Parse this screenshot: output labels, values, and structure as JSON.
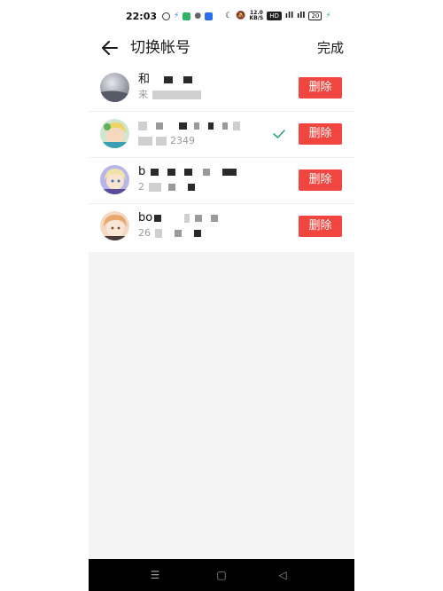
{
  "status_bar": {
    "time": "22:03",
    "net_speed": "12.0",
    "net_unit": "KB/S",
    "hd_label": "HD",
    "signal_1": "5G",
    "signal_2": "4G",
    "battery": "20"
  },
  "header": {
    "title": "切换帐号",
    "done_label": "完成"
  },
  "accounts": [
    {
      "name": "和",
      "sub": "来",
      "selected": false,
      "delete_label": "删除"
    },
    {
      "name": "",
      "sub": "2349",
      "selected": true,
      "delete_label": "删除"
    },
    {
      "name": "b",
      "sub": "2",
      "selected": false,
      "delete_label": "删除"
    },
    {
      "name": "bo",
      "sub": "26",
      "selected": false,
      "delete_label": "删除"
    }
  ],
  "colors": {
    "accent_red": "#f1463f",
    "check_green": "#2aa67a"
  },
  "icons": [
    "back-arrow-icon",
    "checkmark-icon",
    "menu-icon",
    "home-icon",
    "back-triangle-icon"
  ]
}
